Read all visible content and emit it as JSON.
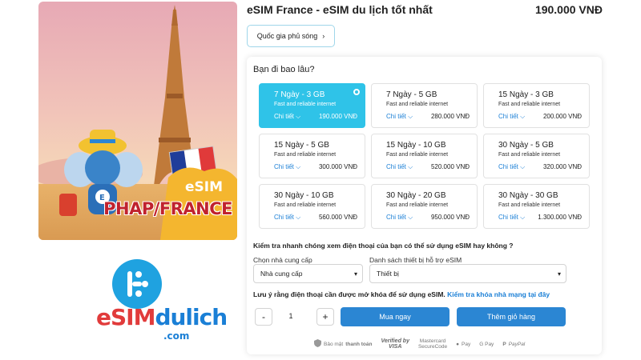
{
  "product": {
    "title": "eSIM France - eSIM du lịch tốt nhất",
    "price": "190.000 VNĐ",
    "coverage_button": "Quốc gia phủ sóng"
  },
  "hero": {
    "esim_text": "eSIM",
    "destination_text": "PHAP/FRANCE"
  },
  "logo": {
    "text_a": "eSIM",
    "text_b": "dulich",
    "domain": ".com"
  },
  "duration_question": "Bạn đi bao lâu?",
  "plans": [
    {
      "name": "7 Ngày - 3 GB",
      "subtitle": "Fast and reliable internet",
      "detail": "Chi tiết",
      "price": "190.000 VNĐ",
      "selected": true
    },
    {
      "name": "7 Ngày - 5 GB",
      "subtitle": "Fast and reliable internet",
      "detail": "Chi tiết",
      "price": "280.000 VNĐ",
      "selected": false
    },
    {
      "name": "15 Ngày - 3 GB",
      "subtitle": "Fast and reliable internet",
      "detail": "Chi tiết",
      "price": "200.000 VNĐ",
      "selected": false
    },
    {
      "name": "15 Ngày - 5 GB",
      "subtitle": "Fast and reliable internet",
      "detail": "Chi tiết",
      "price": "300.000 VNĐ",
      "selected": false
    },
    {
      "name": "15 Ngày - 10 GB",
      "subtitle": "Fast and reliable internet",
      "detail": "Chi tiết",
      "price": "520.000 VNĐ",
      "selected": false
    },
    {
      "name": "30 Ngày - 5 GB",
      "subtitle": "Fast and reliable internet",
      "detail": "Chi tiết",
      "price": "320.000 VNĐ",
      "selected": false
    },
    {
      "name": "30 Ngày - 10 GB",
      "subtitle": "Fast and reliable internet",
      "detail": "Chi tiết",
      "price": "560.000 VNĐ",
      "selected": false
    },
    {
      "name": "30 Ngày - 20 GB",
      "subtitle": "Fast and reliable internet",
      "detail": "Chi tiết",
      "price": "950.000 VNĐ",
      "selected": false
    },
    {
      "name": "30 Ngày - 30 GB",
      "subtitle": "Fast and reliable internet",
      "detail": "Chi tiết",
      "price": "1.300.000 VNĐ",
      "selected": false
    }
  ],
  "compat": {
    "heading": "Kiểm tra nhanh chóng xem điện thoại của bạn có thể sử dụng eSIM hay không ?",
    "provider_label": "Chọn nhà cung cấp",
    "provider_value": "Nhà cung cấp",
    "device_label": "Danh sách thiết bị hỗ trợ eSIM",
    "device_value": "Thiết bị",
    "note": "Lưu ý rằng điện thoại cần được mở khóa để sử dụng eSIM.",
    "note_link": "Kiểm tra khóa nhà mạng tại đây"
  },
  "purchase": {
    "minus": "-",
    "quantity": "1",
    "plus": "+",
    "buy_label": "Mua ngay",
    "cart_label": "Thêm giỏ hàng"
  },
  "payment": {
    "secure_text": "Bảo mật",
    "secure_strong": "thanh toán",
    "visa_line1": "Verified by",
    "visa_line2": "VISA",
    "mc_line1": "Mastercard",
    "mc_line2": "SecureCode",
    "apple_pay": "Pay",
    "google_pay": "G Pay",
    "paypal": "PayPal"
  },
  "colors": {
    "selected_plan": "#2fc3e8",
    "primary_button": "#2b86d3",
    "link": "#1a7fd6",
    "brand_red": "#e13b3b"
  }
}
